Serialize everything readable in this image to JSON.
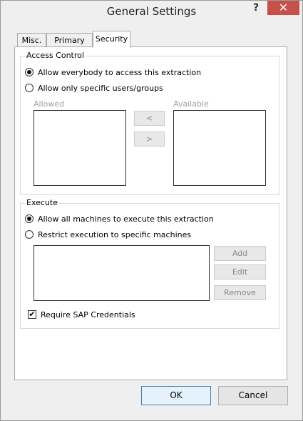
{
  "window": {
    "title": "General Settings",
    "help_glyph": "?",
    "close_glyph": "✕"
  },
  "tabs": [
    {
      "label": "Misc.",
      "active": false
    },
    {
      "label": "Primary Key",
      "active": false
    },
    {
      "label": "Security",
      "active": true
    }
  ],
  "access_control": {
    "legend": "Access Control",
    "radio_everybody": "Allow everybody to access this extraction",
    "radio_specific": "Allow only specific users/groups",
    "allowed_label": "Allowed",
    "available_label": "Available",
    "move_left": "<",
    "move_right": ">",
    "selected": "everybody"
  },
  "execute": {
    "legend": "Execute",
    "radio_all": "Allow all machines to execute this extraction",
    "radio_restrict": "Restrict execution to specific machines",
    "add": "Add",
    "edit": "Edit",
    "remove": "Remove",
    "selected": "all"
  },
  "require_sap": {
    "label": "Require SAP Credentials",
    "checked": true,
    "check_glyph": "✔"
  },
  "footer": {
    "ok": "OK",
    "cancel": "Cancel"
  }
}
